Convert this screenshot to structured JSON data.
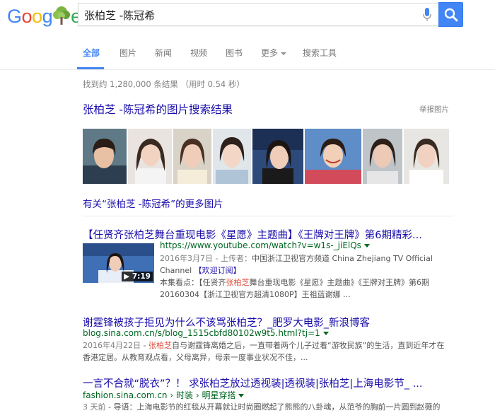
{
  "logo": {
    "text": "Google"
  },
  "search": {
    "query": "张柏芝 -陈冠希"
  },
  "tabs": [
    {
      "label": "全部"
    },
    {
      "label": "图片"
    },
    {
      "label": "新闻"
    },
    {
      "label": "视频"
    },
    {
      "label": "图书"
    },
    {
      "label": "更多"
    },
    {
      "label": "搜索工具"
    }
  ],
  "stats": "找到约 1,280,000 条结果 （用时 0.54 秒）",
  "images": {
    "title": "张柏芝 -陈冠希的图片搜索结果",
    "report": "举报图片",
    "more": "有关“张柏芝 -陈冠希”的更多图片"
  },
  "results": [
    {
      "title": "【任贤齐张柏芝舞台重现电影《星愿》主题曲】《王牌对王牌》第6期精彩...",
      "url": "https://www.youtube.com/watch?v=w1s-_jiElQs",
      "meta_date": "2016年3月7日 - 上传者：",
      "meta_uploader": "中国浙江卫视官方频道 China Zhejiang TV Official",
      "meta_channel": "Channel",
      "meta_subscribe": "【欢迎订阅】",
      "snippet_prefix": "本集看点：【任贤齐",
      "snippet_hl": "张柏芝",
      "snippet_suffix": "舞台重现电影《星愿》主题曲》《王牌对王牌》第6期",
      "snippet2": "20160304【浙江卫视官方超清1080P】王祖蓝谢娜 ...",
      "duration": "▶ 7:19"
    },
    {
      "title": "谢霆锋被孩子拒见为什么不该骂张柏芝？_肥罗大电影_新浪博客",
      "url": "blog.sina.com.cn/s/blog_1515cbfd80102w9t5.html?tj=1",
      "date": "2016年4月22日",
      "snippet_pre": " - ",
      "snippet_hl": "张柏芝",
      "snippet_suffix": "自与谢霆锋离婚之后，一直带着两个儿子过着“游牧民族”的生活，直到近年才在",
      "snippet2": "香港定居。从教育观点看，父母离异，母亲一度事业状况不佳，..."
    },
    {
      "title": "一言不合就“脱衣”？！ 求张柏芝放过透视装|透视装|张柏芝|上海电影节_ ...",
      "url_domain": "fashion.sina.com.cn",
      "url_sep": " › ",
      "url_crumb1": "时装",
      "url_crumb2": "明星穿搭",
      "date": "3 天前",
      "snippet": " - 导语：上海电影节的红毯从开幕就让时尚圈燃起了熊熊的八卦魂，从范爷的胸前一片圆到赵薇的"
    }
  ],
  "colors": {
    "accent": "#4285f4",
    "link": "#1a0dab",
    "url": "#006621",
    "highlight": "#dd4b39"
  }
}
